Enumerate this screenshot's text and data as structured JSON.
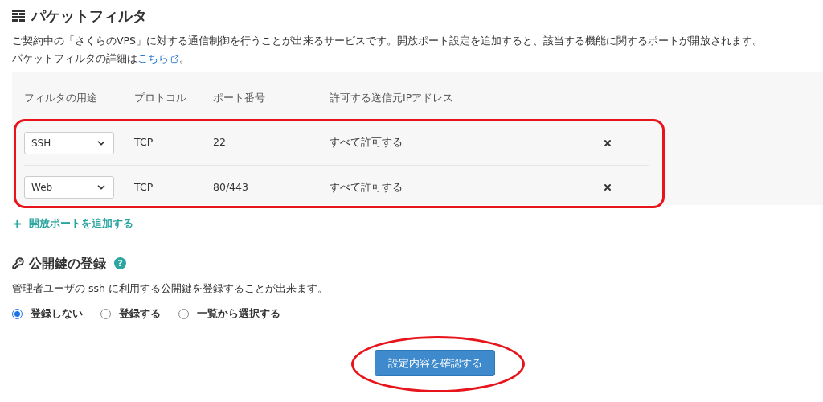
{
  "packet_filter": {
    "title": "パケットフィルタ",
    "description": "ご契約中の「さくらのVPS」に対する通信制御を行うことが出来るサービスです。開放ポート設定を追加すると、該当する機能に関するポートが開放されます。",
    "detail_prefix": "パケットフィルタの詳細は",
    "detail_link": "こちら",
    "detail_suffix": "。",
    "table": {
      "columns": [
        "フィルタの用途",
        "プロトコル",
        "ポート番号",
        "許可する送信元IPアドレス"
      ],
      "rows": [
        {
          "usage": "SSH",
          "protocol": "TCP",
          "port": "22",
          "source": "すべて許可する"
        },
        {
          "usage": "Web",
          "protocol": "TCP",
          "port": "80/443",
          "source": "すべて許可する"
        }
      ]
    },
    "add_link": "開放ポートを追加する"
  },
  "public_key": {
    "title": "公開鍵の登録",
    "help_icon": "?",
    "description": "管理者ユーザの ssh に利用する公開鍵を登録することが出来ます。",
    "options": [
      {
        "label": "登録しない",
        "selected": true
      },
      {
        "label": "登録する",
        "selected": false
      },
      {
        "label": "一覧から選択する",
        "selected": false
      }
    ]
  },
  "confirm_button": "設定内容を確認する"
}
